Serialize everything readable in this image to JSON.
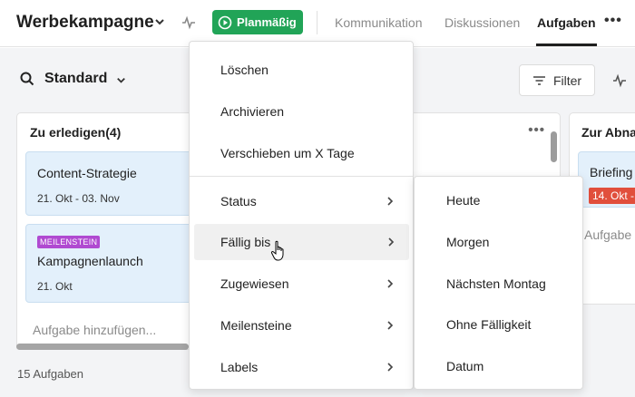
{
  "header": {
    "project_title": "Werbekampagne",
    "status_label": "Planmäßig",
    "nav": [
      {
        "label": "Kommunikation"
      },
      {
        "label": "Diskussionen"
      },
      {
        "label": "Aufgaben"
      }
    ],
    "more_label": "•••"
  },
  "toolbar": {
    "view_label": "Standard",
    "filter_label": "Filter"
  },
  "columns": [
    {
      "title": "Zu erledigen(4)",
      "more_label": "•••",
      "cards": [
        {
          "title": "Content-Strategie",
          "date": "21. Okt - 03. Nov"
        },
        {
          "badge": "MEILENSTEIN",
          "title": "Kampagnenlaunch",
          "date": "21. Okt"
        }
      ],
      "add_task": "Aufgabe hinzufügen..."
    },
    {
      "title": "Zur Abna",
      "cards": [
        {
          "title": "Briefing",
          "date": "14. Okt -"
        }
      ],
      "add_task": "Aufgabe"
    }
  ],
  "footer": {
    "task_count": "15 Aufgaben"
  },
  "context_menu": {
    "items": [
      {
        "label": "Löschen"
      },
      {
        "label": "Archivieren"
      },
      {
        "label": "Verschieben um X Tage"
      },
      {
        "label": "Status"
      },
      {
        "label": "Fällig bis"
      },
      {
        "label": "Zugewiesen"
      },
      {
        "label": "Meilensteine"
      },
      {
        "label": "Labels"
      }
    ]
  },
  "submenu": {
    "items": [
      {
        "label": "Heute"
      },
      {
        "label": "Morgen"
      },
      {
        "label": "Nächsten Montag"
      },
      {
        "label": "Ohne Fälligkeit"
      },
      {
        "label": "Datum"
      }
    ]
  },
  "colors": {
    "status_green": "#21a457",
    "card_bg": "#e3f0fb",
    "milestone_purple": "#b04ad1",
    "overdue_red": "#e14f3c"
  }
}
